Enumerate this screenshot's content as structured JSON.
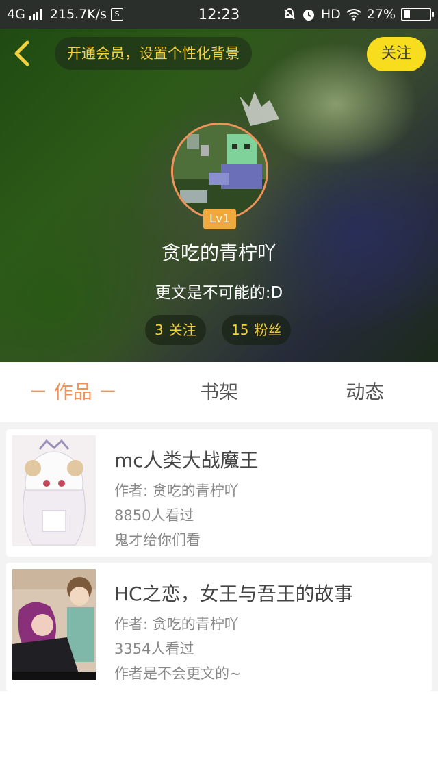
{
  "status_bar": {
    "network": "4G",
    "speed": "215.7K/s",
    "s_badge": "S",
    "time": "12:23",
    "hd": "HD",
    "battery": "27%",
    "battery_level": 0.27
  },
  "header": {
    "vip_banner": "开通会员，设置个性化背景",
    "follow_button": "关注",
    "level_badge": "Lv1",
    "username": "贪吃的青柠吖",
    "bio": "更文是不可能的:D",
    "stats": [
      {
        "count": "3",
        "label": "关注"
      },
      {
        "count": "15",
        "label": "粉丝"
      }
    ]
  },
  "tabs": [
    {
      "label": "－ 作品 －",
      "active": true
    },
    {
      "label": "书架",
      "active": false
    },
    {
      "label": "动态",
      "active": false
    }
  ],
  "works": [
    {
      "title": "mc人类大战魔王",
      "author": "作者: 贪吃的青柠吖",
      "views": "8850人看过",
      "description": "鬼才给你们看"
    },
    {
      "title": "HC之恋，女王与吾王的故事",
      "author": "作者: 贪吃的青柠吖",
      "views": "3354人看过",
      "description": "作者是不会更文的~"
    }
  ],
  "colors": {
    "accent": "#f0935a",
    "gold": "#f3d23e",
    "follow_bg": "#f7dd1d"
  }
}
